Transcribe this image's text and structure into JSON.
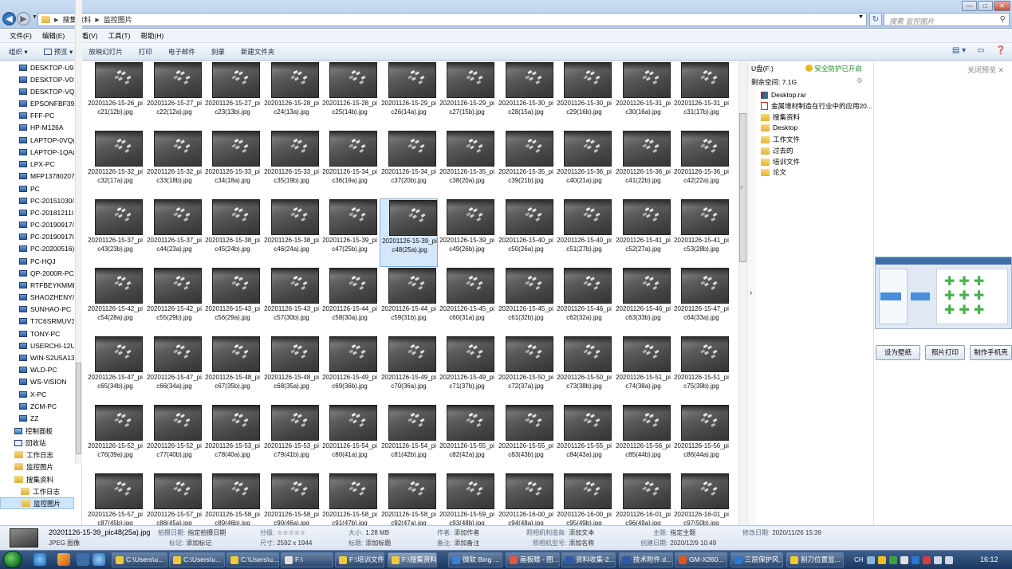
{
  "window": {
    "controls": [
      "—",
      "□",
      "✕"
    ]
  },
  "address": {
    "crumbs": [
      "搜集资料",
      "监控图片"
    ],
    "search_placeholder": "搜索 监控图片"
  },
  "menu": [
    "文件(F)",
    "编辑(E)",
    "查看(V)",
    "工具(T)",
    "帮助(H)"
  ],
  "commands": [
    "组织 ▾",
    "预览 ▾",
    "放映幻灯片",
    "打印",
    "电子邮件",
    "刻录",
    "新建文件夹"
  ],
  "nav": [
    "DESKTOP-U9I",
    "DESKTOP-V0S",
    "DESKTOP-VQ",
    "EPSONFBF39E",
    "FFF-PC",
    "HP-M126A",
    "LAPTOP-0VQ(",
    "LAPTOP-1QA(",
    "LPX-PC",
    "MFP13780207",
    "PC",
    "PC-20151030/",
    "PC-20181211I",
    "PC-20190917/",
    "PC-20190917I",
    "PC-20200516)",
    "PC-HQJ",
    "QP-2000R-PC",
    "RTFBEYKMME",
    "SHAOZHENY/",
    "SUNHAO-PC",
    "T7C6SRMUV3",
    "TONY-PC",
    "USERCHI-12U",
    "WIN-S2U5A13",
    "WLD-PC",
    "WS-VISION",
    "X-PC",
    "ZCM-PC",
    "ZZ",
    "控制面板",
    "回收站",
    "工作日志",
    "监控图片",
    "搜集资料",
    "工作日志",
    "监控图片"
  ],
  "files": [
    "20201126-15-26_pic21(12b).jpg",
    "20201126-15-27_pic22(12a).jpg",
    "20201126-15-27_pic23(13b).jpg",
    "20201126-15-28_pic24(13a).jpg",
    "20201126-15-28_pic25(14b).jpg",
    "20201126-15-29_pic26(14a).jpg",
    "20201126-15-29_pic27(15b).jpg",
    "20201126-15-30_pic28(15a).jpg",
    "20201126-15-30_pic29(16b).jpg",
    "20201126-15-31_pic30(16a).jpg",
    "20201126-15-31_pic31(17b).jpg",
    "20201126-15-32_pic32(17a).jpg",
    "20201126-15-32_pic33(18b).jpg",
    "20201126-15-33_pic34(18a).jpg",
    "20201126-15-33_pic35(19b).jpg",
    "20201126-15-34_pic36(19a).jpg",
    "20201126-15-34_pic37(20b).jpg",
    "20201126-15-35_pic38(20a).jpg",
    "20201126-15-35_pic39(21b).jpg",
    "20201126-15-36_pic40(21a).jpg",
    "20201126-15-36_pic41(22b).jpg",
    "20201126-15-36_pic42(22a).jpg",
    "20201126-15-37_pic43(23b).jpg",
    "20201126-15-37_pic44(23a).jpg",
    "20201126-15-38_pic45(24b).jpg",
    "20201126-15-38_pic46(24a).jpg",
    "20201126-15-39_pic47(25b).jpg",
    "20201126-15-39_pic48(25a).jpg",
    "20201126-15-39_pic49(26b).jpg",
    "20201126-15-40_pic50(26a).jpg",
    "20201126-15-40_pic51(27b).jpg",
    "20201126-15-41_pic52(27a).jpg",
    "20201126-15-41_pic53(28b).jpg",
    "20201126-15-42_pic54(28a).jpg",
    "20201126-15-42_pic55(29b).jpg",
    "20201126-15-43_pic56(29a).jpg",
    "20201126-15-43_pic57(30b).jpg",
    "20201126-15-44_pic58(30a).jpg",
    "20201126-15-44_pic59(31b).jpg",
    "20201126-15-45_pic60(31a).jpg",
    "20201126-15-45_pic61(32b).jpg",
    "20201126-15-46_pic62(32a).jpg",
    "20201126-15-46_pic63(33b).jpg",
    "20201126-15-47_pic64(33a).jpg",
    "20201126-15-47_pic65(34b).jpg",
    "20201126-15-47_pic66(34a).jpg",
    "20201126-15-48_pic67(35b).jpg",
    "20201126-15-48_pic68(35a).jpg",
    "20201126-15-49_pic69(36b).jpg",
    "20201126-15-49_pic70(36a).jpg",
    "20201126-15-49_pic71(37b).jpg",
    "20201126-15-50_pic72(37a).jpg",
    "20201126-15-50_pic73(38b).jpg",
    "20201126-15-51_pic74(38a).jpg",
    "20201126-15-51_pic75(39b).jpg",
    "20201126-15-52_pic76(39a).jpg",
    "20201126-15-52_pic77(40b).jpg",
    "20201126-15-53_pic78(40a).jpg",
    "20201126-15-53_pic79(41b).jpg",
    "20201126-15-54_pic80(41a).jpg",
    "20201126-15-54_pic81(42b).jpg",
    "20201126-15-55_pic82(42a).jpg",
    "20201126-15-55_pic83(43b).jpg",
    "20201126-15-55_pic84(43a).jpg",
    "20201126-15-56_pic85(44b).jpg",
    "20201126-15-56_pic86(44a).jpg",
    "20201126-15-57_pic87(45b).jpg",
    "20201126-15-57_pic88(45a).jpg",
    "20201126-15-58_pic89(46b).jpg",
    "20201126-15-58_pic90(46a).jpg",
    "20201126-15-58_pic91(47b).jpg",
    "20201126-15-58_pic92(47a).jpg",
    "20201126-15-59_pic93(48b).jpg",
    "20201126-16-00_pic94(48a).jpg",
    "20201126-16-00_pic95(49b).jpg",
    "20201126-16-01_pic96(49a).jpg",
    "20201126-16-01_pic97(50b).jpg"
  ],
  "selected_file": "20201126-15-39_pic48(25a).jpg",
  "drive": {
    "name": "U盘(F:)",
    "protect": "安全防护已开启",
    "free": "剩余空间: 7.1G",
    "items": [
      "Desktop.rar",
      "金属增材制造在行业中的应用20...",
      "搜集资料",
      "Desktop",
      "工作文件",
      "过去的",
      "培训文件",
      "论文"
    ]
  },
  "preview": {
    "close": "关闭预览",
    "buttons": [
      "设为壁纸",
      "照片打印",
      "制作手机壳"
    ]
  },
  "details": {
    "filename": "20201126-15-39_pic48(25a).jpg",
    "type": "JPEG 图像",
    "fields": [
      [
        "拍摄日期:",
        "指定拍摄日期"
      ],
      [
        "标记:",
        "添加标记"
      ],
      [
        "分级:",
        "☆☆☆☆☆"
      ],
      [
        "尺寸:",
        "2592 x 1944"
      ],
      [
        "大小:",
        "1.28 MB"
      ],
      [
        "标题:",
        "添加标题"
      ],
      [
        "作者:",
        "添加作者"
      ],
      [
        "备注:",
        "添加备注"
      ],
      [
        "照相机制造商:",
        "添加文本"
      ],
      [
        "照相机型号:",
        "添加名称"
      ],
      [
        "主题:",
        "指定主题"
      ],
      [
        "创建日期:",
        "2020/12/9 10:49"
      ],
      [
        "修改日期:",
        "2020/11/26 15:39"
      ]
    ]
  },
  "taskbar": {
    "items": [
      "C:\\Users\\u...",
      "C:\\Users\\u...",
      "C:\\Users\\u...",
      "F:\\",
      "F:\\培训文件",
      "F:\\搜集资料",
      "微软 Bing ...",
      "画板睛 - 图...",
      "资料收集-2...",
      "技术附件.d...",
      "GM-X260...",
      "三层保护风...",
      "割刀位置监..."
    ],
    "tray": [
      "CH"
    ],
    "clock": "16:12"
  },
  "colors": {
    "accent": "#2c5aa0",
    "selection": "#d5e7fb",
    "protect": "#2a8a2a"
  }
}
